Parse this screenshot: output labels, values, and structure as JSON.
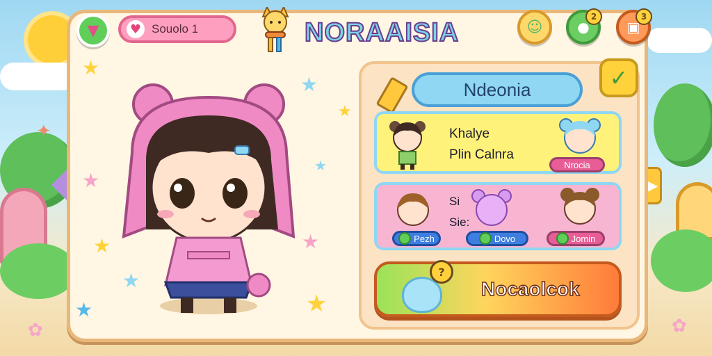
{
  "header": {
    "score_text": "Souolo 1",
    "logo_text": "NORAAISIA",
    "badges": {
      "friends": "",
      "coins": "2",
      "shop": "3"
    }
  },
  "panel": {
    "title": "Ndeonia",
    "card1": {
      "line1": "Khalye",
      "line2": "Plin Calnra",
      "tag": "Nrocia"
    },
    "card2": {
      "line1": "Si",
      "line2": "Sie:",
      "tags": [
        "Pezh",
        "Dovo",
        "Jomin"
      ]
    },
    "action_button": {
      "label": "Nocaolcok",
      "badge": "?"
    }
  },
  "icons": {
    "top_left": "filter-funnel-icon",
    "score": "heart-icon",
    "friends": "character-icon",
    "coins": "coin-icon",
    "shop": "shop-bag-icon",
    "edit": "pencil-icon",
    "confirm": "check-icon",
    "nav_left": "arrow-left-icon",
    "nav_right": "arrow-right-icon"
  },
  "colors": {
    "frame": "#fff6e3",
    "frame_border": "#e9b77a",
    "title_pill": "#8fd7f2",
    "card1": "#fff27a",
    "card2": "#f8b5d2",
    "accent_green": "#5fbf5a",
    "accent_orange": "#ff7b3a"
  }
}
